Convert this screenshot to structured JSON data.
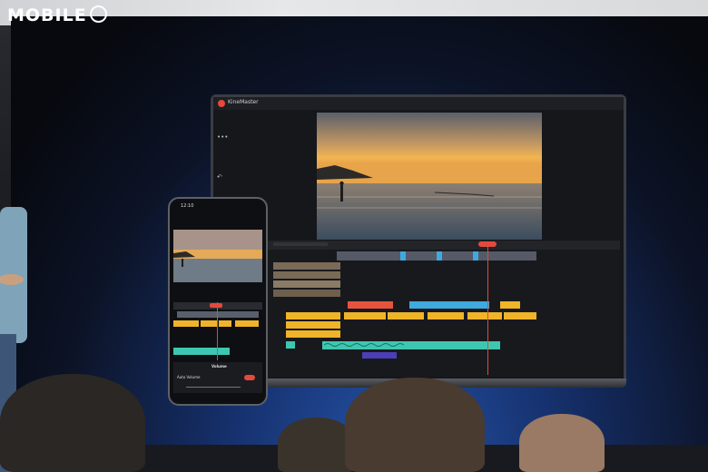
{
  "watermark": {
    "brand_text": "MOBILE"
  },
  "laptop_app": {
    "title": "KineMaster",
    "accent_color": "#e34a3d",
    "icons": [
      "more-icon",
      "undo-icon"
    ]
  },
  "phone_app": {
    "clock": "12:10",
    "panel_title": "Volume",
    "panel_row_label": "Auto Volume",
    "accent_color": "#e24a3e"
  },
  "timeline_colors": {
    "clip_orange": "#f0b429",
    "clip_red": "#e8533d",
    "clip_blue": "#3fa9e0",
    "audio_teal": "#3ec7b0",
    "voice_purple": "#4b3fb5"
  }
}
